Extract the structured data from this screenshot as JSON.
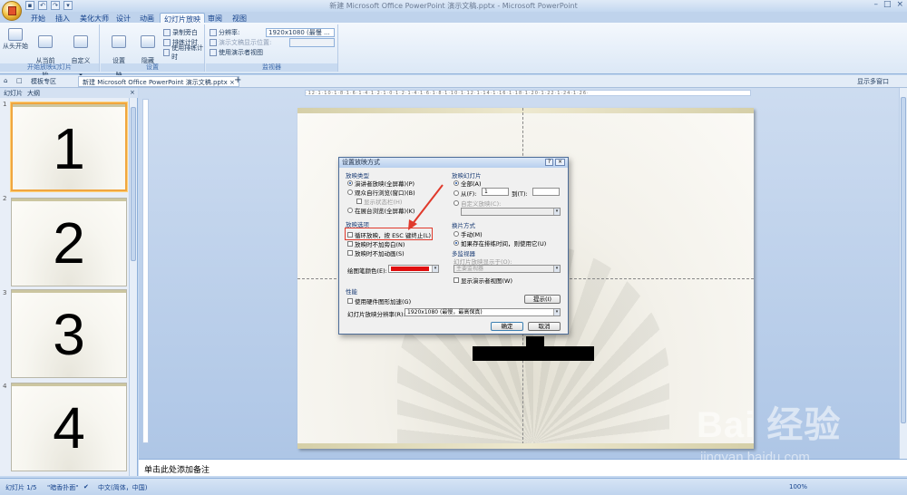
{
  "window": {
    "title": "新建 Microsoft Office PowerPoint 演示文稿.pptx - Microsoft PowerPoint"
  },
  "ribbon_tabs": [
    "开始",
    "插入",
    "美化大师",
    "设计",
    "动画",
    "幻灯片放映",
    "审阅",
    "视图"
  ],
  "active_tab": "幻灯片放映",
  "ribbon": {
    "group1": {
      "label": "开始放映幻灯片",
      "btn_from_start": "从头开始",
      "btn_from_current": "从当前\n幻灯片开始",
      "btn_custom": "自定义\n幻灯片放映 ▾"
    },
    "group2": {
      "label": "设置",
      "btn_setup": "设置\n幻灯片放映",
      "btn_hide": "隐藏\n幻灯片",
      "record": "录制旁白",
      "rehearse": "排练计时",
      "use_timings": "使用排练计时"
    },
    "group3": {
      "label": "监视器",
      "resolution_label": "分辨率:",
      "resolution_value": "1920x1080 (最慢 ...",
      "show_on_label": "演示文稿显示位置:",
      "presenter_view": "使用演示者视图"
    }
  },
  "doc_strip": {
    "template": "模板专区",
    "doc_tab": "新建 Microsoft Office PowerPoint 演示文稿.pptx",
    "show_multi": "显示多窗口"
  },
  "left_panel": {
    "tab_slides": "幻灯片",
    "tab_outline": "大纲",
    "slides": [
      {
        "idx": "1",
        "label": "1"
      },
      {
        "idx": "2",
        "label": "2"
      },
      {
        "idx": "3",
        "label": "3"
      },
      {
        "idx": "4",
        "label": "4"
      }
    ]
  },
  "notes_placeholder": "单击此处添加备注",
  "status": {
    "slide_info": "幻灯片 1/5",
    "theme": "\"暗香扑面\"",
    "language": "中文(简体，中国)",
    "zoom": "100%"
  },
  "dialog": {
    "title": "设置放映方式",
    "help": "?",
    "close": "×",
    "show_type": {
      "header": "放映类型",
      "opt1": "演讲者放映(全屏幕)(P)",
      "opt2": "观众自行浏览(窗口)(B)",
      "show_scrollbar": "显示状态栏(H)",
      "opt3": "在展台浏览(全屏幕)(K)"
    },
    "show_options": {
      "header": "放映选项",
      "loop": "循环放映，按 ESC 键终止(L)",
      "no_narration": "放映时不加旁白(N)",
      "no_animation": "放映时不加动画(S)"
    },
    "pen_color_label": "绘图笔颜色(E):",
    "pen_color": "#e01010",
    "slides_section": {
      "header": "放映幻灯片",
      "all": "全部(A)",
      "from": "从(F):",
      "from_value": "1",
      "to": "到(T):",
      "to_value": "",
      "custom": "自定义放映(C):"
    },
    "advance": {
      "header": "换片方式",
      "manual": "手动(M)",
      "timings": "如果存在排练时间，则使用它(U)"
    },
    "monitors": {
      "header": "多监视器",
      "show_on": "幻灯片放映显示于(O):",
      "primary": "主要监视器",
      "presenter_view": "显示演示者视图(W)"
    },
    "performance": {
      "header": "性能",
      "hw_accel": "使用硬件图形加速(G)",
      "tips": "提示(I)",
      "resolution_label": "幻灯片放映分辨率(R):",
      "resolution_value": "1920x1080 (最慢，最高保真)"
    },
    "ok": "确定",
    "cancel": "取消"
  },
  "watermark": {
    "brand": "Bai 经验",
    "url": "jingyan.baidu.com"
  }
}
